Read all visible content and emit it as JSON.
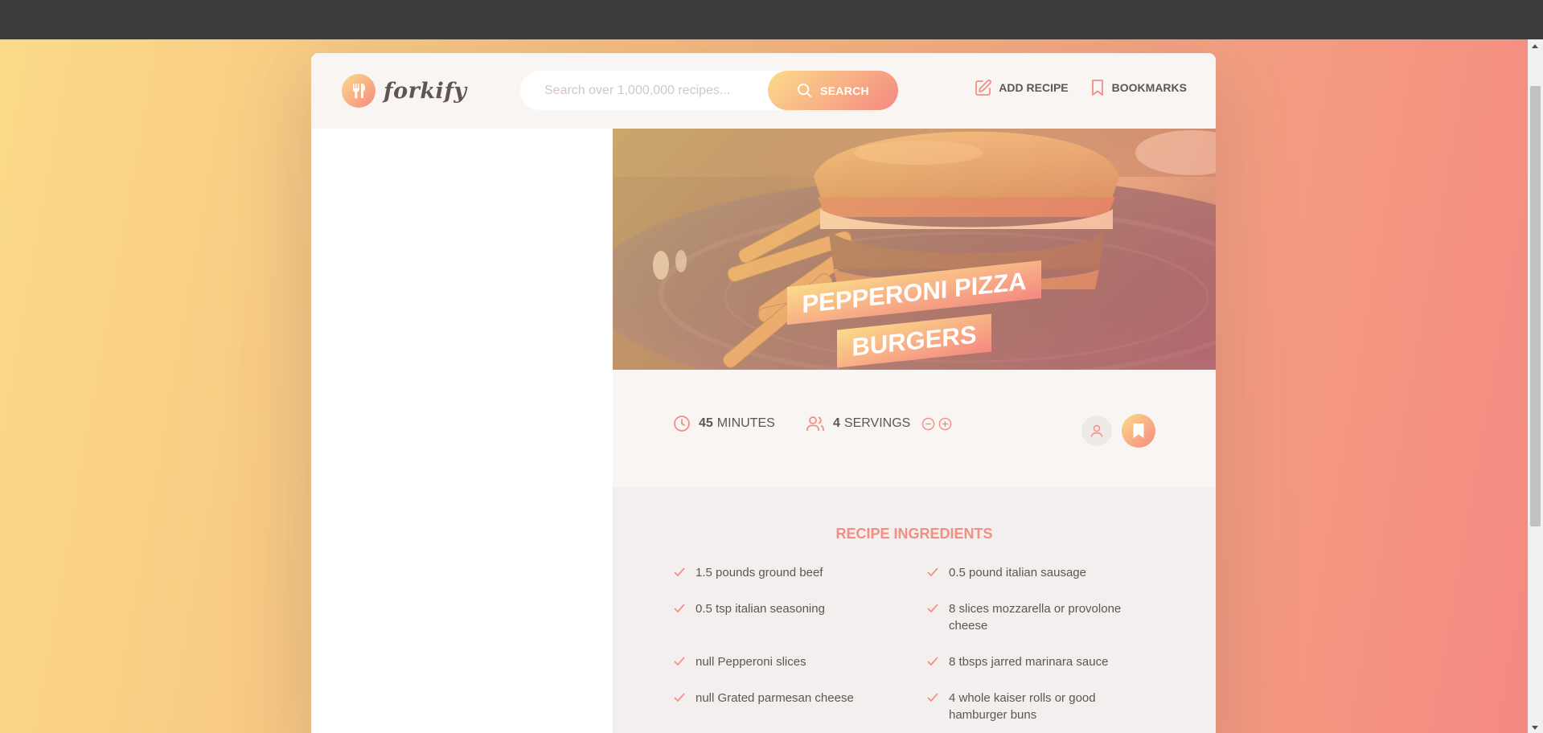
{
  "app": {
    "logo_text": "forkify",
    "accent_gradient": [
      "#fbdb89",
      "#f48982"
    ],
    "text_color": "#615551"
  },
  "search": {
    "placeholder": "Search over 1,000,000 recipes...",
    "button_label": "SEARCH"
  },
  "nav": {
    "add_recipe": "ADD RECIPE",
    "bookmarks": "BOOKMARKS"
  },
  "recipe": {
    "title_line1": "PEPPERONI PIZZA",
    "title_line2": "BURGERS",
    "cooking_time": "45",
    "cooking_time_unit": "MINUTES",
    "servings": "4",
    "servings_unit": "SERVINGS"
  },
  "ingredients": {
    "heading": "RECIPE INGREDIENTS",
    "items": [
      {
        "text": "1.5 pounds ground beef"
      },
      {
        "text": "0.5 pound italian sausage"
      },
      {
        "text": "0.5 tsp italian seasoning"
      },
      {
        "text": "8 slices mozzarella or provolone cheese"
      },
      {
        "text": "null Pepperoni slices"
      },
      {
        "text": "8 tbsps jarred marinara sauce"
      },
      {
        "text": "null Grated parmesan cheese"
      },
      {
        "text": "4 whole kaiser rolls or good hamburger buns"
      }
    ]
  },
  "icons": {
    "logo": "fork-spoon-icon",
    "search": "search-icon",
    "add_recipe": "edit-icon",
    "bookmarks": "bookmark-icon",
    "time": "clock-icon",
    "servings": "users-icon",
    "decrease": "minus-circle-icon",
    "increase": "plus-circle-icon",
    "user_generated": "user-icon",
    "bookmark_recipe": "bookmark-fill-icon",
    "ingredient": "check-icon"
  }
}
